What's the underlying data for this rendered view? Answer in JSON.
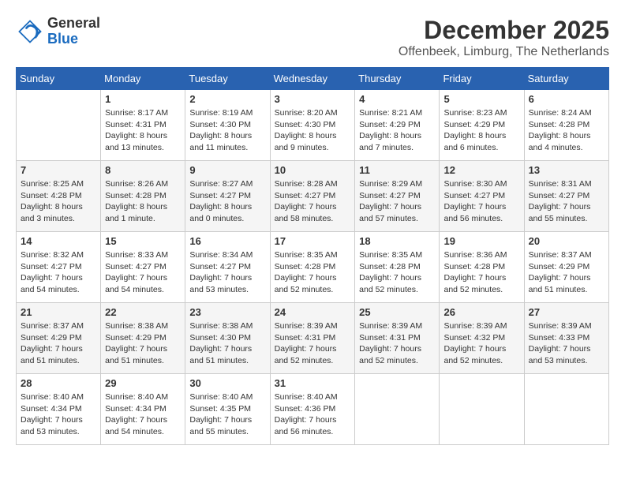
{
  "logo": {
    "general": "General",
    "blue": "Blue"
  },
  "title": "December 2025",
  "location": "Offenbeek, Limburg, The Netherlands",
  "days_header": [
    "Sunday",
    "Monday",
    "Tuesday",
    "Wednesday",
    "Thursday",
    "Friday",
    "Saturday"
  ],
  "weeks": [
    [
      {
        "day": "",
        "info": ""
      },
      {
        "day": "1",
        "info": "Sunrise: 8:17 AM\nSunset: 4:31 PM\nDaylight: 8 hours\nand 13 minutes."
      },
      {
        "day": "2",
        "info": "Sunrise: 8:19 AM\nSunset: 4:30 PM\nDaylight: 8 hours\nand 11 minutes."
      },
      {
        "day": "3",
        "info": "Sunrise: 8:20 AM\nSunset: 4:30 PM\nDaylight: 8 hours\nand 9 minutes."
      },
      {
        "day": "4",
        "info": "Sunrise: 8:21 AM\nSunset: 4:29 PM\nDaylight: 8 hours\nand 7 minutes."
      },
      {
        "day": "5",
        "info": "Sunrise: 8:23 AM\nSunset: 4:29 PM\nDaylight: 8 hours\nand 6 minutes."
      },
      {
        "day": "6",
        "info": "Sunrise: 8:24 AM\nSunset: 4:28 PM\nDaylight: 8 hours\nand 4 minutes."
      }
    ],
    [
      {
        "day": "7",
        "info": "Sunrise: 8:25 AM\nSunset: 4:28 PM\nDaylight: 8 hours\nand 3 minutes."
      },
      {
        "day": "8",
        "info": "Sunrise: 8:26 AM\nSunset: 4:28 PM\nDaylight: 8 hours\nand 1 minute."
      },
      {
        "day": "9",
        "info": "Sunrise: 8:27 AM\nSunset: 4:27 PM\nDaylight: 8 hours\nand 0 minutes."
      },
      {
        "day": "10",
        "info": "Sunrise: 8:28 AM\nSunset: 4:27 PM\nDaylight: 7 hours\nand 58 minutes."
      },
      {
        "day": "11",
        "info": "Sunrise: 8:29 AM\nSunset: 4:27 PM\nDaylight: 7 hours\nand 57 minutes."
      },
      {
        "day": "12",
        "info": "Sunrise: 8:30 AM\nSunset: 4:27 PM\nDaylight: 7 hours\nand 56 minutes."
      },
      {
        "day": "13",
        "info": "Sunrise: 8:31 AM\nSunset: 4:27 PM\nDaylight: 7 hours\nand 55 minutes."
      }
    ],
    [
      {
        "day": "14",
        "info": "Sunrise: 8:32 AM\nSunset: 4:27 PM\nDaylight: 7 hours\nand 54 minutes."
      },
      {
        "day": "15",
        "info": "Sunrise: 8:33 AM\nSunset: 4:27 PM\nDaylight: 7 hours\nand 54 minutes."
      },
      {
        "day": "16",
        "info": "Sunrise: 8:34 AM\nSunset: 4:27 PM\nDaylight: 7 hours\nand 53 minutes."
      },
      {
        "day": "17",
        "info": "Sunrise: 8:35 AM\nSunset: 4:28 PM\nDaylight: 7 hours\nand 52 minutes."
      },
      {
        "day": "18",
        "info": "Sunrise: 8:35 AM\nSunset: 4:28 PM\nDaylight: 7 hours\nand 52 minutes."
      },
      {
        "day": "19",
        "info": "Sunrise: 8:36 AM\nSunset: 4:28 PM\nDaylight: 7 hours\nand 52 minutes."
      },
      {
        "day": "20",
        "info": "Sunrise: 8:37 AM\nSunset: 4:29 PM\nDaylight: 7 hours\nand 51 minutes."
      }
    ],
    [
      {
        "day": "21",
        "info": "Sunrise: 8:37 AM\nSunset: 4:29 PM\nDaylight: 7 hours\nand 51 minutes."
      },
      {
        "day": "22",
        "info": "Sunrise: 8:38 AM\nSunset: 4:29 PM\nDaylight: 7 hours\nand 51 minutes."
      },
      {
        "day": "23",
        "info": "Sunrise: 8:38 AM\nSunset: 4:30 PM\nDaylight: 7 hours\nand 51 minutes."
      },
      {
        "day": "24",
        "info": "Sunrise: 8:39 AM\nSunset: 4:31 PM\nDaylight: 7 hours\nand 52 minutes."
      },
      {
        "day": "25",
        "info": "Sunrise: 8:39 AM\nSunset: 4:31 PM\nDaylight: 7 hours\nand 52 minutes."
      },
      {
        "day": "26",
        "info": "Sunrise: 8:39 AM\nSunset: 4:32 PM\nDaylight: 7 hours\nand 52 minutes."
      },
      {
        "day": "27",
        "info": "Sunrise: 8:39 AM\nSunset: 4:33 PM\nDaylight: 7 hours\nand 53 minutes."
      }
    ],
    [
      {
        "day": "28",
        "info": "Sunrise: 8:40 AM\nSunset: 4:34 PM\nDaylight: 7 hours\nand 53 minutes."
      },
      {
        "day": "29",
        "info": "Sunrise: 8:40 AM\nSunset: 4:34 PM\nDaylight: 7 hours\nand 54 minutes."
      },
      {
        "day": "30",
        "info": "Sunrise: 8:40 AM\nSunset: 4:35 PM\nDaylight: 7 hours\nand 55 minutes."
      },
      {
        "day": "31",
        "info": "Sunrise: 8:40 AM\nSunset: 4:36 PM\nDaylight: 7 hours\nand 56 minutes."
      },
      {
        "day": "",
        "info": ""
      },
      {
        "day": "",
        "info": ""
      },
      {
        "day": "",
        "info": ""
      }
    ]
  ]
}
